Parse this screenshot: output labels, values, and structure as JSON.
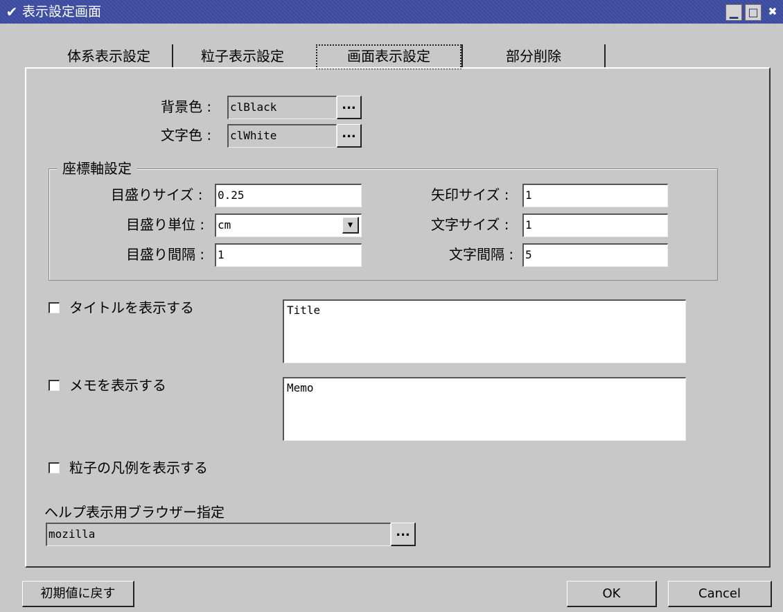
{
  "window": {
    "title": "表示設定画面",
    "menu_icon": "chevron-down-icon",
    "minimize_icon": "minimize-icon",
    "maximize_icon": "maximize-icon",
    "close_icon": "close-icon"
  },
  "tabs": [
    {
      "label": "体系表示設定",
      "active": false
    },
    {
      "label": "粒子表示設定",
      "active": false
    },
    {
      "label": "画面表示設定",
      "active": true
    },
    {
      "label": "部分削除",
      "active": false
    }
  ],
  "colors": {
    "background_label": "背景色 :",
    "background_value": "clBlack",
    "text_label": "文字色 :",
    "text_value": "clWhite",
    "picker_label": "..."
  },
  "axis": {
    "group_title": "座標軸設定",
    "tick_size_label": "目盛りサイズ :",
    "tick_size_value": "0.25",
    "tick_unit_label": "目盛り単位 :",
    "tick_unit_value": "cm",
    "tick_interval_label": "目盛り間隔 :",
    "tick_interval_value": "1",
    "arrow_size_label": "矢印サイズ :",
    "arrow_size_value": "1",
    "char_size_label": "文字サイズ :",
    "char_size_value": "1",
    "char_spacing_label": "文字間隔 :",
    "char_spacing_value": "5"
  },
  "options": {
    "show_title_label": "タイトルを表示する",
    "title_text": "Title",
    "show_memo_label": "メモを表示する",
    "memo_text": "Memo",
    "show_legend_label": "粒子の凡例を表示する"
  },
  "help": {
    "label": "ヘルプ表示用ブラウザー指定",
    "value": "mozilla",
    "picker_label": "..."
  },
  "buttons": {
    "reset": "初期値に戻す",
    "ok": "OK",
    "cancel": "Cancel"
  }
}
